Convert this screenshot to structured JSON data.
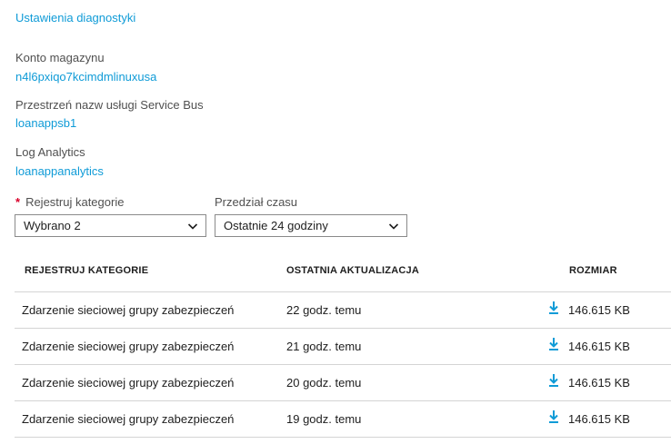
{
  "diagnostics_link": "Ustawienia diagnostyki",
  "storage": {
    "label": "Konto magazynu",
    "value": "n4l6pxiqo7kcimdmlinuxusa"
  },
  "servicebus": {
    "label": "Przestrzeń nazw usługi Service Bus",
    "value": "loanappsb1"
  },
  "loganalytics": {
    "label": "Log Analytics",
    "value": "loanappanalytics"
  },
  "filters": {
    "category": {
      "required_mark": "*",
      "label": "Rejestruj kategorie",
      "selected": "Wybrano 2"
    },
    "timerange": {
      "label": "Przedział czasu",
      "selected": "Ostatnie 24 godziny"
    }
  },
  "table": {
    "headers": {
      "category": "REJESTRUJ KATEGORIE",
      "updated": "OSTATNIA AKTUALIZACJA",
      "size": "ROZMIAR"
    },
    "rows": [
      {
        "category": "Zdarzenie sieciowej grupy zabezpieczeń",
        "updated": "22 godz. temu",
        "size": "146.615 KB"
      },
      {
        "category": "Zdarzenie sieciowej grupy zabezpieczeń",
        "updated": "21 godz. temu",
        "size": "146.615 KB"
      },
      {
        "category": "Zdarzenie sieciowej grupy zabezpieczeń",
        "updated": "20 godz. temu",
        "size": "146.615 KB"
      },
      {
        "category": "Zdarzenie sieciowej grupy zabezpieczeń",
        "updated": "19 godz. temu",
        "size": "146.615 KB"
      }
    ]
  },
  "icons": {
    "download": "download-icon",
    "chevron": "chevron-down-icon"
  },
  "colors": {
    "link": "#0f9bd7",
    "required": "#d9002a",
    "border": "#8a8a8a"
  }
}
